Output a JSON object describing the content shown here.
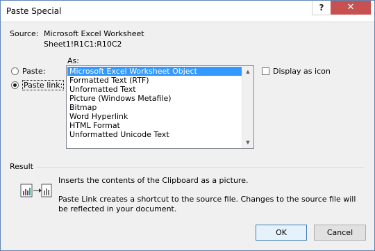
{
  "window": {
    "title": "Paste Special",
    "help_glyph": "?",
    "close_glyph": "✕"
  },
  "source": {
    "label": "Source:",
    "value": "Microsoft Excel Worksheet",
    "range": "Sheet1!R1C1:R10C2"
  },
  "as": {
    "label": "As:"
  },
  "radio_options": [
    {
      "label": "Paste:",
      "checked": false
    },
    {
      "label": "Paste link:",
      "checked": true
    }
  ],
  "list": {
    "items": [
      "Microsoft Excel Worksheet Object",
      "Formatted Text (RTF)",
      "Unformatted Text",
      "Picture (Windows Metafile)",
      "Bitmap",
      "Word Hyperlink",
      "HTML Format",
      "Unformatted Unicode Text"
    ],
    "selected_index": 0
  },
  "display_as_icon": {
    "label": "Display as icon",
    "checked": false
  },
  "result": {
    "label": "Result",
    "line1": "Inserts the contents of the Clipboard as a picture.",
    "line2": "Paste Link creates a shortcut to the source file. Changes to the source file will be reflected in your document."
  },
  "buttons": {
    "ok": "OK",
    "cancel": "Cancel"
  },
  "colors": {
    "selection": "#3399ff",
    "close_button": "#c75050",
    "ok_border": "#3c7fb1"
  }
}
